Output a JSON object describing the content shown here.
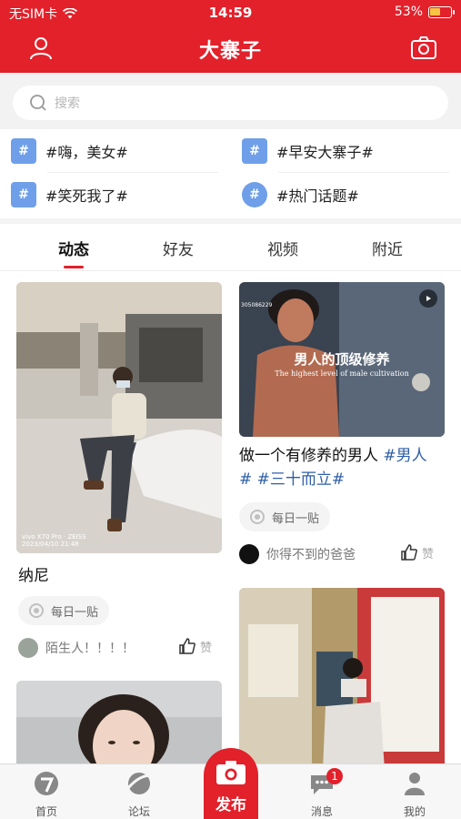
{
  "status_bar": {
    "carrier": "无SIM卡",
    "time": "14:59",
    "battery_percent": "53%",
    "battery_level": 0.53
  },
  "header": {
    "title": "大寨子"
  },
  "search": {
    "placeholder": "搜索"
  },
  "topics": [
    {
      "label": "#嗨，美女#"
    },
    {
      "label": "#早安大寨子#"
    },
    {
      "label": "#笑死我了#"
    },
    {
      "label": "#热门话题#"
    }
  ],
  "tabs": [
    {
      "label": "动态",
      "active": true
    },
    {
      "label": "好友"
    },
    {
      "label": "视频"
    },
    {
      "label": "附近"
    }
  ],
  "posts": [
    {
      "title": "纳尼",
      "tag": "每日一贴",
      "author": "陌生人！！！！",
      "like_label": "赞",
      "photo_caption_line1": "vivo X70 Pro · ZEISS",
      "photo_caption_line2": "2023/04/10 21:48"
    },
    {
      "title_text": "做一个有修养的男人 ",
      "hashtag1": "#男人",
      "hashtag2": "#",
      "hashtag3": " #三十而立#",
      "tag": "每日一贴",
      "author": "你得不到的爸爸",
      "like_label": "赞",
      "video_title": "男人的顶级修养",
      "video_subtitle": "The highest level of male cultivation",
      "video_code": "305086229"
    }
  ],
  "bottom_nav": {
    "home": "首页",
    "forum": "论坛",
    "publish": "发布",
    "messages": "消息",
    "messages_badge": "1",
    "mine": "我的"
  },
  "colors": {
    "brand_red": "#e2212b",
    "hashtag_blue": "#2f5fa7",
    "topic_icon_blue": "#6f9fe8"
  }
}
